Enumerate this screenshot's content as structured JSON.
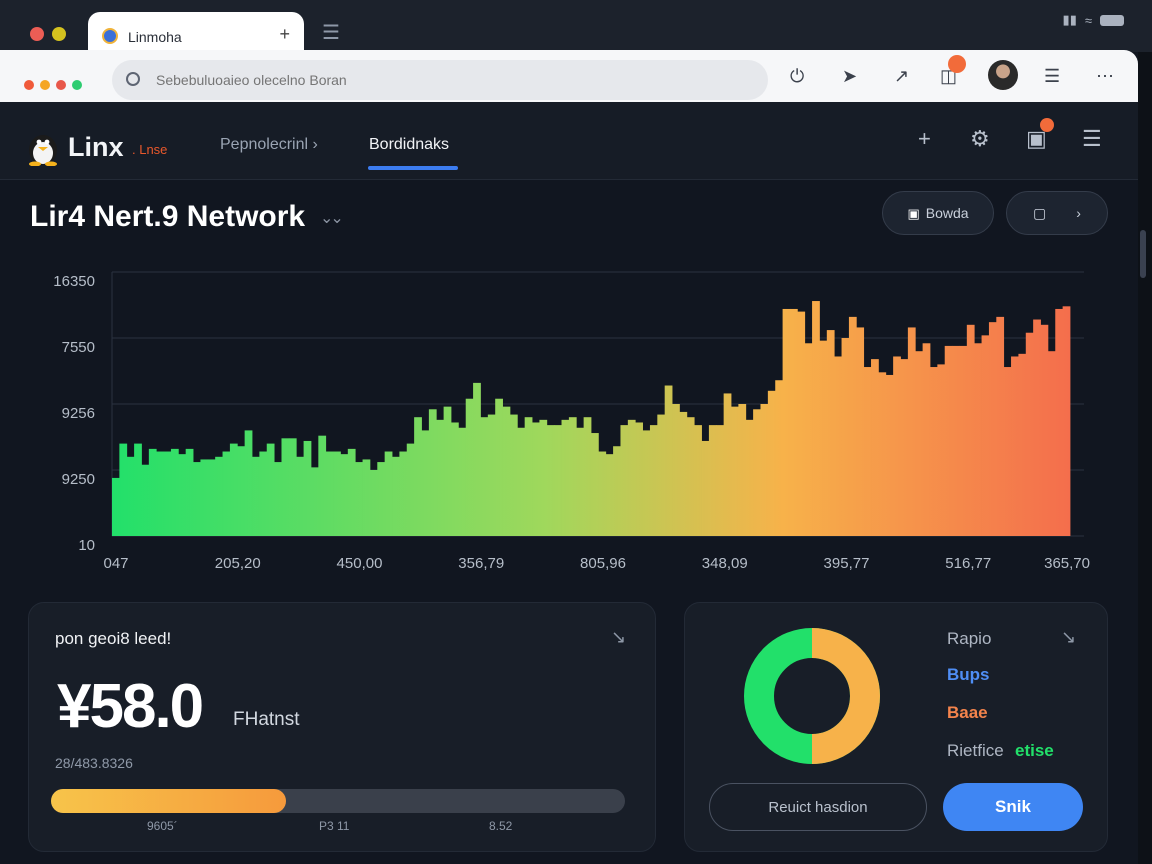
{
  "browser": {
    "tab_title": "Linmoha",
    "tab_pin": "+",
    "url_placeholder": "Sebebuluoaieo olecelno Boran"
  },
  "app": {
    "logo_text": "Linx",
    "logo_tag": ". Lnse",
    "nav": [
      {
        "label": "Pepnolecrinl ›"
      },
      {
        "label": "Bordidnaks"
      }
    ]
  },
  "page": {
    "title": "Lir4 Nert.9 Network",
    "browse_label": "Bowda",
    "colors": {
      "accent": "#3c7cf0",
      "green": "#22e06a",
      "orange": "#f46e4c",
      "bg": "#111620"
    }
  },
  "chart_data": {
    "type": "bar",
    "gradient": [
      "#22e06a",
      "#b8d45a",
      "#f7b24a",
      "#f46e4c"
    ],
    "y_tick_labels": [
      "16350",
      "7550",
      "9256",
      "9250",
      "10"
    ],
    "x_tick_labels": [
      "047",
      "205,20",
      "450,00",
      "356,79",
      "805,96",
      "348,09",
      "395,77",
      "516,77",
      "365,70"
    ],
    "ylim": [
      0,
      1000
    ],
    "grid": true,
    "values": [
      220,
      350,
      300,
      350,
      270,
      330,
      320,
      320,
      330,
      310,
      330,
      280,
      290,
      290,
      300,
      320,
      350,
      340,
      400,
      300,
      320,
      350,
      280,
      370,
      370,
      300,
      360,
      260,
      380,
      320,
      320,
      310,
      330,
      280,
      290,
      250,
      280,
      320,
      300,
      320,
      350,
      450,
      400,
      480,
      440,
      490,
      430,
      410,
      520,
      580,
      450,
      460,
      520,
      490,
      460,
      410,
      450,
      430,
      440,
      420,
      420,
      440,
      450,
      410,
      450,
      390,
      320,
      310,
      340,
      420,
      440,
      430,
      400,
      420,
      460,
      570,
      500,
      470,
      450,
      420,
      360,
      420,
      420,
      540,
      490,
      500,
      440,
      480,
      500,
      550,
      590,
      860,
      860,
      850,
      730,
      890,
      740,
      780,
      680,
      750,
      830,
      790,
      640,
      670,
      620,
      610,
      680,
      670,
      790,
      700,
      730,
      640,
      650,
      720,
      720,
      720,
      800,
      730,
      760,
      810,
      830,
      640,
      680,
      690,
      770,
      820,
      800,
      700,
      860,
      870
    ]
  },
  "stats_card": {
    "label": "pon geoi8 leed!",
    "value": "¥58.0",
    "unit": "FHatnst",
    "sub_value": "28/483.8326",
    "progress": 0.41,
    "ticks": [
      "9605´",
      "P3 11",
      "8.52"
    ]
  },
  "status_card": {
    "legend": [
      {
        "label": "Rapio",
        "color": "#aeb6c3"
      },
      {
        "label": "Bups",
        "color": "#4f8ef5"
      },
      {
        "label": "Baae",
        "color": "#f4844c"
      }
    ],
    "footer_label": "Rietfice",
    "footer_value": "etise",
    "donut": [
      {
        "label": "green",
        "value": 0.5,
        "color": "#22e06a"
      },
      {
        "label": "warm",
        "value": 0.5,
        "color": "#f7b24a"
      }
    ],
    "outline_button": "Reuict hasdion",
    "primary_button": "Snik"
  }
}
